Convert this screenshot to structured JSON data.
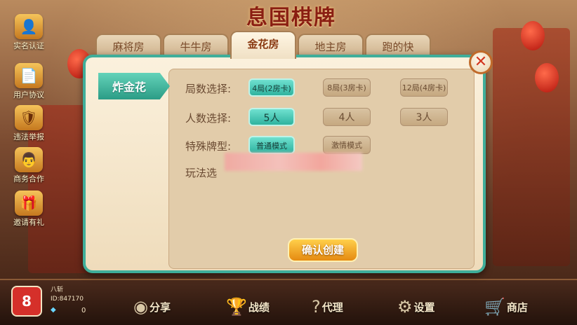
{
  "app_title": "息国棋牌",
  "left_menu": [
    {
      "label": "实名认证",
      "icon": "id-card-icon",
      "glyph": "👤"
    },
    {
      "label": "用户协议",
      "icon": "document-icon",
      "glyph": "📄"
    },
    {
      "label": "违法举报",
      "icon": "report-icon",
      "glyph": "🛡"
    },
    {
      "label": "商务合作",
      "icon": "handshake-icon",
      "glyph": "👨"
    },
    {
      "label": "邀请有礼",
      "icon": "gift-icon",
      "glyph": "🎁"
    }
  ],
  "tabs": [
    {
      "label": "麻将房",
      "active": false
    },
    {
      "label": "牛牛房",
      "active": false
    },
    {
      "label": "金花房",
      "active": true
    },
    {
      "label": "地主房",
      "active": false
    },
    {
      "label": "跑的快",
      "active": false
    }
  ],
  "dialog": {
    "game_tag": "炸金花",
    "close_glyph": "✕",
    "rounds": {
      "label": "局数选择:",
      "options": [
        {
          "label": "4局(2房卡)",
          "selected": true
        },
        {
          "label": "8局(3房卡)",
          "selected": false
        },
        {
          "label": "12局(4房卡)",
          "selected": false
        }
      ]
    },
    "players": {
      "label": "人数选择:",
      "options": [
        {
          "label": "5人",
          "selected": true
        },
        {
          "label": "4人",
          "selected": false
        },
        {
          "label": "3人",
          "selected": false
        }
      ]
    },
    "special": {
      "label": "特殊牌型:",
      "options": [
        {
          "label": "普通模式",
          "selected": true
        },
        {
          "label": "激情模式",
          "selected": false
        }
      ]
    },
    "rules": {
      "label": "玩法选"
    },
    "confirm_label": "确认创建"
  },
  "profile": {
    "name": "八斩",
    "id_text": "ID:847170",
    "diamonds": "0",
    "avatar_glyph": "8"
  },
  "bottom_nav": [
    {
      "label": "分享",
      "icon": "share-icon",
      "glyph": "◉"
    },
    {
      "label": "战绩",
      "icon": "trophy-icon",
      "glyph": "🏆"
    },
    {
      "label": "代理",
      "icon": "question-icon",
      "glyph": "?"
    },
    {
      "label": "设置",
      "icon": "gear-icon",
      "glyph": "⚙"
    },
    {
      "label": "商店",
      "icon": "cart-icon",
      "glyph": "🛒"
    }
  ],
  "colors": {
    "accent_teal": "#2eb39f",
    "confirm_orange": "#e58a11",
    "close_red": "#d2361e",
    "title_red": "#8a1e12"
  }
}
